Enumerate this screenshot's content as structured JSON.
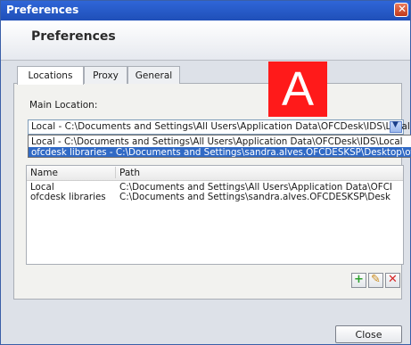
{
  "window": {
    "title": "Preferences"
  },
  "header": {
    "title": "Preferences"
  },
  "tabs": [
    {
      "label": "Locations",
      "active": true
    },
    {
      "label": "Proxy",
      "active": false
    },
    {
      "label": "General",
      "active": false
    }
  ],
  "main_location": {
    "label": "Main Location:",
    "selected_value": "Local - C:\\Documents and Settings\\All Users\\Application Data\\OFCDesk\\IDS\\Local",
    "options": [
      "Local - C:\\Documents and Settings\\All Users\\Application Data\\OFCDesk\\IDS\\Local",
      "ofcdesk libraries - C:\\Documents and Settings\\sandra.alves.OFCDESKSP\\Desktop\\ofcdes"
    ]
  },
  "table": {
    "columns": [
      "Name",
      "Path"
    ],
    "rows": [
      {
        "name": "Local",
        "path": "C:\\Documents and Settings\\All Users\\Application Data\\OFCI"
      },
      {
        "name": "ofcdesk libraries",
        "path": "C:\\Documents and Settings\\sandra.alves.OFCDESKSP\\Desk"
      }
    ]
  },
  "action_buttons": {
    "add_icon": "plus-icon",
    "edit_icon": "pencil-icon",
    "delete_icon": "x-icon"
  },
  "footer": {
    "close_label": "Close"
  },
  "overlay_label": "A",
  "colors": {
    "titlebar": "#2f66d8",
    "selection": "#316ac5",
    "add": "#2ca02c",
    "delete": "#d62728",
    "overlay": "#ff1a1a"
  }
}
